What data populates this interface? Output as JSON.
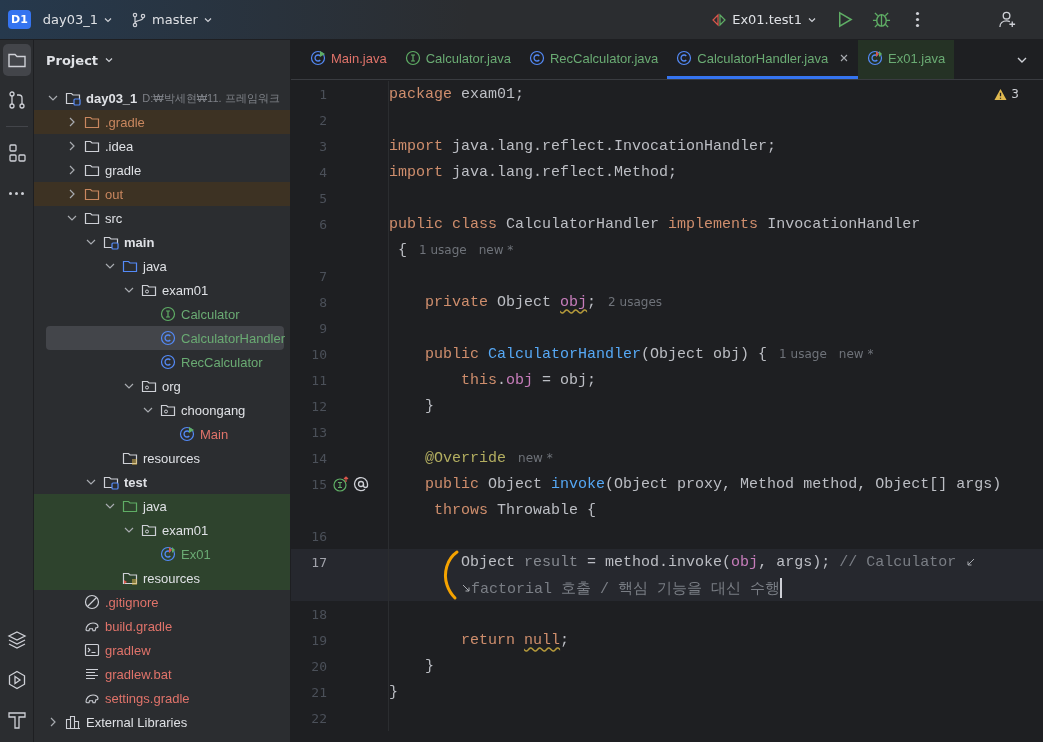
{
  "top_bar": {
    "badge": "D1",
    "project": "day03_1",
    "branch": "master",
    "run_config": "Ex01.test1"
  },
  "tool_strip": {
    "top": [
      {
        "kind": "folder",
        "selected": true
      },
      {
        "kind": "commit",
        "selected": false
      },
      {
        "kind": "structure",
        "selected": false
      },
      {
        "kind": "more",
        "selected": false
      }
    ],
    "bottom": [
      {
        "kind": "layers",
        "selected": false
      },
      {
        "kind": "services",
        "selected": false
      },
      {
        "kind": "build",
        "selected": false
      }
    ]
  },
  "project_panel": {
    "title": "Project",
    "tree": [
      {
        "label": "day03_1",
        "kind": "module",
        "path": "D:₩박세현₩11. 프레임워크",
        "color": "#dfe1e5",
        "excluded": false,
        "test_scope": false,
        "expanded": true,
        "selected": false,
        "children": [
          {
            "label": ".gradle",
            "kind": "folder",
            "color": "#c9875f",
            "excluded": true,
            "test_scope": false,
            "expanded": false,
            "selected": false
          },
          {
            "label": ".idea",
            "kind": "folder",
            "color": "#dfe1e5",
            "excluded": false,
            "test_scope": false,
            "expanded": false,
            "selected": false
          },
          {
            "label": "gradle",
            "kind": "folder",
            "color": "#dfe1e5",
            "excluded": false,
            "test_scope": false,
            "expanded": false,
            "selected": false
          },
          {
            "label": "out",
            "kind": "folder",
            "color": "#c9875f",
            "excluded": true,
            "test_scope": false,
            "expanded": false,
            "selected": false
          },
          {
            "label": "src",
            "kind": "folder",
            "color": "#dfe1e5",
            "excluded": false,
            "test_scope": false,
            "expanded": true,
            "selected": false,
            "children": [
              {
                "label": "main",
                "kind": "module",
                "color": "#dfe1e5",
                "excluded": false,
                "test_scope": false,
                "expanded": true,
                "selected": false,
                "children": [
                  {
                    "label": "java",
                    "kind": "source-folder",
                    "color": "#dfe1e5",
                    "excluded": false,
                    "test_scope": false,
                    "expanded": true,
                    "selected": false,
                    "children": [
                      {
                        "label": "exam01",
                        "kind": "package",
                        "color": "#dfe1e5",
                        "excluded": false,
                        "test_scope": false,
                        "expanded": true,
                        "selected": false,
                        "children": [
                          {
                            "label": "Calculator",
                            "kind": "interface",
                            "color": "#6aab73",
                            "excluded": false,
                            "test_scope": false,
                            "selected": false
                          },
                          {
                            "label": "CalculatorHandler",
                            "kind": "class",
                            "color": "#6aab73",
                            "excluded": false,
                            "test_scope": false,
                            "selected": true
                          },
                          {
                            "label": "RecCalculator",
                            "kind": "class",
                            "color": "#6aab73",
                            "excluded": false,
                            "test_scope": false,
                            "selected": false
                          }
                        ]
                      },
                      {
                        "label": "org",
                        "kind": "package",
                        "color": "#dfe1e5",
                        "excluded": false,
                        "test_scope": false,
                        "expanded": true,
                        "selected": false,
                        "children": [
                          {
                            "label": "choongang",
                            "kind": "package",
                            "color": "#dfe1e5",
                            "excluded": false,
                            "test_scope": false,
                            "expanded": true,
                            "selected": false,
                            "children": [
                              {
                                "label": "Main",
                                "kind": "class-main",
                                "color": "#e0736a",
                                "excluded": false,
                                "test_scope": false,
                                "selected": false
                              }
                            ]
                          }
                        ]
                      }
                    ]
                  },
                  {
                    "label": "resources",
                    "kind": "resources",
                    "color": "#dfe1e5",
                    "excluded": false,
                    "test_scope": false,
                    "selected": false
                  }
                ]
              },
              {
                "label": "test",
                "kind": "module",
                "color": "#dfe1e5",
                "excluded": false,
                "test_scope": false,
                "expanded": true,
                "selected": false,
                "children": [
                  {
                    "label": "java",
                    "kind": "test-folder",
                    "color": "#dfe1e5",
                    "excluded": false,
                    "test_scope": true,
                    "expanded": true,
                    "selected": false,
                    "children": [
                      {
                        "label": "exam01",
                        "kind": "package",
                        "color": "#dfe1e5",
                        "excluded": false,
                        "test_scope": true,
                        "expanded": true,
                        "selected": false,
                        "children": [
                          {
                            "label": "Ex01",
                            "kind": "class-test",
                            "color": "#6aab73",
                            "excluded": false,
                            "test_scope": true,
                            "selected": false
                          }
                        ]
                      }
                    ]
                  },
                  {
                    "label": "resources",
                    "kind": "test-resources",
                    "color": "#dfe1e5",
                    "excluded": false,
                    "test_scope": true,
                    "selected": false
                  }
                ]
              }
            ]
          },
          {
            "label": ".gitignore",
            "kind": "ignore-file",
            "color": "#e0736a",
            "excluded": false,
            "test_scope": false,
            "selected": false
          },
          {
            "label": "build.gradle",
            "kind": "gradle",
            "color": "#e0736a",
            "excluded": false,
            "test_scope": false,
            "selected": false
          },
          {
            "label": "gradlew",
            "kind": "terminal",
            "color": "#e0736a",
            "excluded": false,
            "test_scope": false,
            "selected": false
          },
          {
            "label": "gradlew.bat",
            "kind": "text-file",
            "color": "#e0736a",
            "excluded": false,
            "test_scope": false,
            "selected": false
          },
          {
            "label": "settings.gradle",
            "kind": "gradle",
            "color": "#e0736a",
            "excluded": false,
            "test_scope": false,
            "selected": false
          }
        ]
      },
      {
        "label": "External Libraries",
        "kind": "libraries",
        "color": "#dfe1e5",
        "excluded": false,
        "test_scope": false,
        "expanded": false,
        "selected": false
      }
    ]
  },
  "tabs": [
    {
      "label": "Main.java",
      "kind": "class-main",
      "color": "#e0736a",
      "test_scope": false,
      "selected": false
    },
    {
      "label": "Calculator.java",
      "kind": "interface",
      "color": "#6aab73",
      "test_scope": false,
      "selected": false
    },
    {
      "label": "RecCalculator.java",
      "kind": "class",
      "color": "#6aab73",
      "test_scope": false,
      "selected": false
    },
    {
      "label": "CalculatorHandler.java",
      "kind": "class",
      "color": "#6aab73",
      "test_scope": false,
      "selected": true
    },
    {
      "label": "Ex01.java",
      "kind": "class-test",
      "color": "#6aab73",
      "test_scope": true,
      "selected": false
    }
  ],
  "editor": {
    "warnings": "3",
    "lines": [
      {
        "number": "1",
        "current": false,
        "wrapped": false,
        "continued": false,
        "caret": false,
        "tokens": [
          {
            "kind": "kw",
            "text": "package"
          },
          {
            "kind": "plain",
            "text": " exam01;"
          }
        ]
      },
      {
        "number": "2",
        "current": false,
        "wrapped": false,
        "continued": false,
        "caret": false
      },
      {
        "number": "3",
        "current": false,
        "wrapped": false,
        "continued": false,
        "caret": false,
        "tokens": [
          {
            "kind": "kw",
            "text": "import"
          },
          {
            "kind": "plain",
            "text": " java.lang.reflect.InvocationHandler;"
          }
        ]
      },
      {
        "number": "4",
        "current": false,
        "wrapped": false,
        "continued": false,
        "caret": false,
        "tokens": [
          {
            "kind": "kw",
            "text": "import"
          },
          {
            "kind": "plain",
            "text": " java.lang.reflect.Method;"
          }
        ]
      },
      {
        "number": "5",
        "current": false,
        "wrapped": false,
        "continued": false,
        "caret": false
      },
      {
        "number": "6",
        "current": false,
        "wrapped": false,
        "continued": false,
        "caret": false,
        "tokens": [
          {
            "kind": "kw",
            "text": "public class"
          },
          {
            "kind": "plain",
            "text": " CalculatorHandler"
          },
          {
            "kind": "kw",
            "text": " implements"
          },
          {
            "kind": "plain",
            "text": " InvocationHandler"
          }
        ]
      },
      {
        "current": false,
        "wrapped": false,
        "continued": false,
        "caret": false,
        "tokens": [
          {
            "kind": "plain",
            "text": " {"
          },
          {
            "kind": "hint",
            "text": "1 usage"
          },
          {
            "kind": "hint",
            "text": "new *"
          }
        ]
      },
      {
        "number": "7",
        "current": false,
        "wrapped": false,
        "continued": false,
        "caret": false
      },
      {
        "number": "8",
        "current": false,
        "wrapped": false,
        "continued": false,
        "caret": false,
        "tokens": [
          {
            "kind": "kw",
            "text": "    private"
          },
          {
            "kind": "plain",
            "text": " Object"
          },
          {
            "kind": "field_warn",
            "text": " obj"
          },
          {
            "kind": "plain",
            "text": ";"
          },
          {
            "kind": "hint",
            "text": "2 usages"
          }
        ]
      },
      {
        "number": "9",
        "current": false,
        "wrapped": false,
        "continued": false,
        "caret": false
      },
      {
        "number": "10",
        "current": false,
        "wrapped": false,
        "continued": false,
        "caret": false,
        "tokens": [
          {
            "kind": "kw",
            "text": "    public"
          },
          {
            "kind": "fn",
            "text": " CalculatorHandler"
          },
          {
            "kind": "plain",
            "text": "(Object obj) {"
          },
          {
            "kind": "hint",
            "text": "1 usage"
          },
          {
            "kind": "hint",
            "text": "new *"
          }
        ]
      },
      {
        "number": "11",
        "current": false,
        "wrapped": false,
        "continued": false,
        "caret": false,
        "tokens": [
          {
            "kind": "kw",
            "text": "        this"
          },
          {
            "kind": "plain",
            "text": "."
          },
          {
            "kind": "field",
            "text": "obj"
          },
          {
            "kind": "plain",
            "text": " = obj;"
          }
        ]
      },
      {
        "number": "12",
        "current": false,
        "wrapped": false,
        "continued": false,
        "caret": false,
        "tokens": [
          {
            "kind": "plain",
            "text": "    }"
          }
        ]
      },
      {
        "number": "13",
        "current": false,
        "wrapped": false,
        "continued": false,
        "caret": false
      },
      {
        "number": "14",
        "current": false,
        "wrapped": false,
        "continued": false,
        "caret": false,
        "tokens": [
          {
            "kind": "ann",
            "text": "    @Override"
          },
          {
            "kind": "hint",
            "text": "new *"
          }
        ]
      },
      {
        "number": "15",
        "current": false,
        "wrapped": false,
        "continued": false,
        "caret": false,
        "gutter_icons": [
          {
            "kind": "implements"
          },
          {
            "kind": "annotation"
          }
        ],
        "tokens": [
          {
            "kind": "kw",
            "text": "    public"
          },
          {
            "kind": "plain",
            "text": " Object"
          },
          {
            "kind": "fn",
            "text": " invoke"
          },
          {
            "kind": "plain",
            "text": "(Object proxy, Method method, Object[] args)"
          }
        ]
      },
      {
        "current": false,
        "wrapped": false,
        "continued": false,
        "caret": false,
        "tokens": [
          {
            "kind": "kw",
            "text": "     throws"
          },
          {
            "kind": "plain",
            "text": " Throwable {"
          }
        ]
      },
      {
        "number": "16",
        "current": false,
        "wrapped": false,
        "continued": false,
        "caret": false
      },
      {
        "number": "17",
        "current": true,
        "wrapped": true,
        "continued": false,
        "caret": false,
        "tokens": [
          {
            "kind": "plain",
            "text": "        Object"
          },
          {
            "kind": "unused",
            "text": " result"
          },
          {
            "kind": "plain",
            "text": " = method.invoke("
          },
          {
            "kind": "field",
            "text": "obj"
          },
          {
            "kind": "plain",
            "text": ", args);"
          },
          {
            "kind": "comment",
            "text": " // Calculator"
          }
        ]
      },
      {
        "current": true,
        "wrapped": false,
        "continued": true,
        "caret": true,
        "tokens": [
          {
            "kind": "comment",
            "text": "        factorial 호출 / 핵심 기능을 대신 수행"
          }
        ]
      },
      {
        "number": "18",
        "current": false,
        "wrapped": false,
        "continued": false,
        "caret": false
      },
      {
        "number": "19",
        "current": false,
        "wrapped": false,
        "continued": false,
        "caret": false,
        "tokens": [
          {
            "kind": "kw",
            "text": "        return"
          },
          {
            "kind": "kw_warn",
            "text": " null"
          },
          {
            "kind": "plain",
            "text": ";"
          }
        ]
      },
      {
        "number": "20",
        "current": false,
        "wrapped": false,
        "continued": false,
        "caret": false,
        "tokens": [
          {
            "kind": "plain",
            "text": "    }"
          }
        ]
      },
      {
        "number": "21",
        "current": false,
        "wrapped": false,
        "continued": false,
        "caret": false,
        "tokens": [
          {
            "kind": "plain",
            "text": "}"
          }
        ]
      },
      {
        "number": "22",
        "current": false,
        "wrapped": false,
        "continued": false,
        "caret": false
      }
    ]
  }
}
